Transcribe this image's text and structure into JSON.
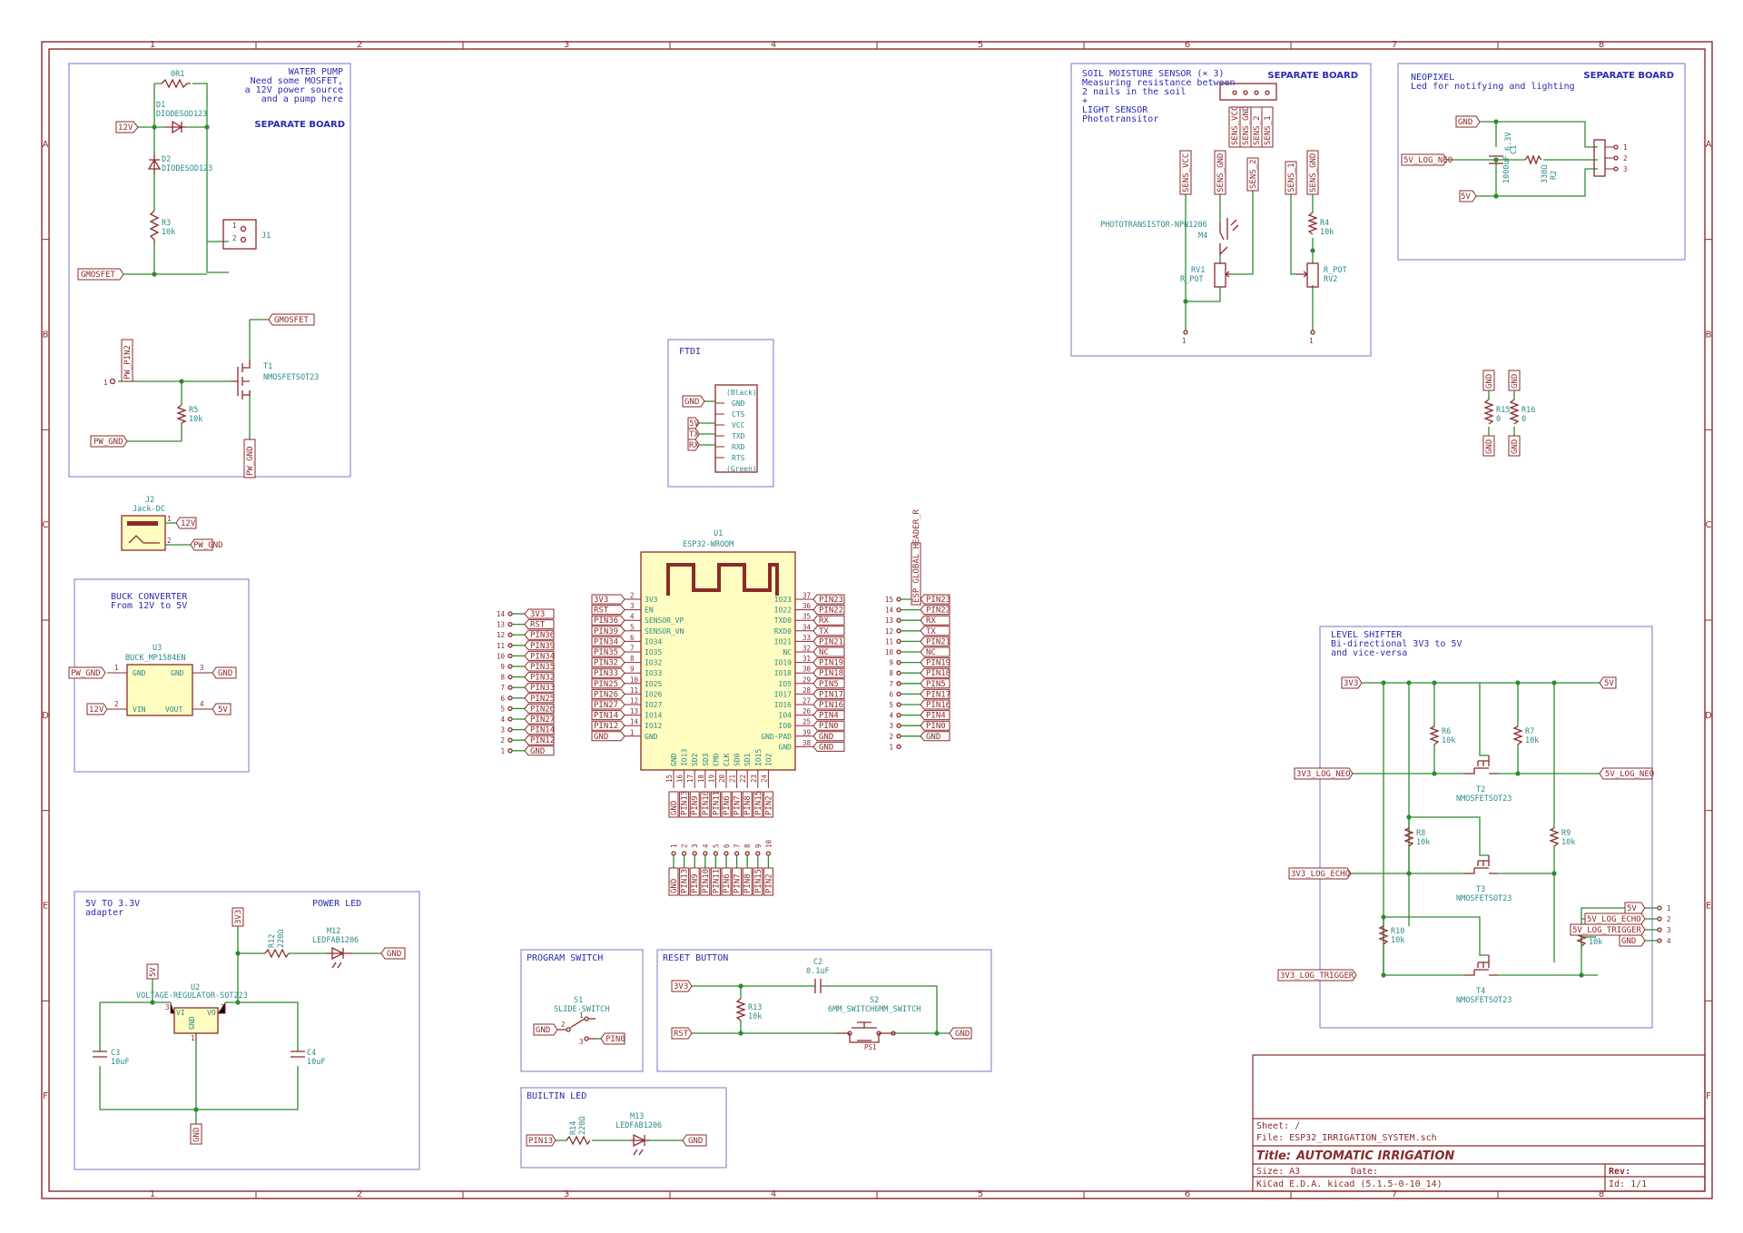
{
  "sheet": {
    "col_labels": [
      "1",
      "2",
      "3",
      "4",
      "5",
      "6",
      "7",
      "8"
    ],
    "row_labels": [
      "A",
      "B",
      "C",
      "D",
      "E",
      "F"
    ]
  },
  "sections": {
    "water_pump": {
      "note": [
        "WATER PUMP",
        "Need some MOSFET,",
        "a 12V power source",
        "and a pump here"
      ],
      "separate": "SEPARATE BOARD"
    },
    "soil": {
      "note": [
        "SOIL MOISTURE SENSOR (× 3)",
        "Measuring resistance between",
        "2 nails in the soil",
        "+",
        "LIGHT SENSOR",
        "Phototransitor"
      ],
      "separate": "SEPARATE BOARD"
    },
    "neopixel": {
      "note": [
        "NEOPIXEL",
        "Led for notifying and lighting"
      ],
      "separate": "SEPARATE BOARD"
    },
    "ftdi": {
      "note": "FTDI"
    },
    "buck": {
      "note": [
        "BUCK CONVERTER",
        "From 12V to 5V"
      ]
    },
    "level_shifter": {
      "note": [
        "LEVEL SHIFTER",
        "Bi-directional 3V3 to 5V",
        "and vice-versa"
      ]
    },
    "regulator": {
      "note": [
        "5V TO 3.3V",
        "adapter"
      ],
      "power_led": "POWER LED"
    },
    "program_switch": {
      "note": "PROGRAM SWITCH"
    },
    "reset_button": {
      "note": "RESET BUTTON"
    },
    "builtin_led": {
      "note": "BUILTIN LED"
    }
  },
  "components": {
    "R1": "0R1",
    "D1": [
      "D1",
      "DIODESOD123"
    ],
    "D2": [
      "D2",
      "DIODESOD123"
    ],
    "R3": [
      "R3",
      "10k"
    ],
    "J1": "J1",
    "T1": [
      "T1",
      "NMOSFETSOT23"
    ],
    "R5": [
      "R5",
      "10k"
    ],
    "J2": [
      "J2",
      "Jack-DC"
    ],
    "U3": [
      "U3",
      "BUCK_MP1584EN"
    ],
    "U1": [
      "U1",
      "ESP32-WROOM"
    ],
    "U2": [
      "U2",
      "VOLTAGE-REGULATOR-SOT223"
    ],
    "C3": [
      "C3",
      "10uF"
    ],
    "C4": [
      "C4",
      "10uF"
    ],
    "R12": [
      "R12",
      "220Ω"
    ],
    "M12": [
      "M12",
      "LEDFAB1206"
    ],
    "S1": [
      "S1",
      "SLIDE-SWITCH"
    ],
    "C2": [
      "C2",
      "0.1uF"
    ],
    "S2": [
      "S2",
      "6MM_SWITCH6MM_SWITCH"
    ],
    "R13": [
      "R13",
      "10k"
    ],
    "R14": [
      "R14",
      "220Ω"
    ],
    "M13": [
      "M13",
      "LEDFAB1206"
    ],
    "M4": "PHOTOTRANSISTOR-NPN1206",
    "M4ref": "M4",
    "RV1": [
      "RV1",
      "R_POT"
    ],
    "RV2": [
      "R_POT",
      "RV2"
    ],
    "R4": [
      "R4",
      "10k"
    ],
    "C1": [
      "1000uF",
      "C1",
      "6.3V"
    ],
    "R2": [
      "330Ω",
      "R2"
    ],
    "R15": "R15",
    "R16": "R16",
    "T2": [
      "T2",
      "NMOSFETSOT23"
    ],
    "T3": [
      "T3",
      "NMOSFETSOT23"
    ],
    "T4": [
      "T4",
      "NMOSFETSOT23"
    ],
    "R6": [
      "R6",
      "10k"
    ],
    "R7": [
      "R7",
      "10k"
    ],
    "R8": [
      "R8",
      "10k"
    ],
    "R9": [
      "R9",
      "10k"
    ],
    "R10": [
      "R10",
      "10k"
    ],
    "R11": [
      "R11",
      "10k"
    ]
  },
  "net_labels": {
    "v12": "12V",
    "v5": "5V",
    "v3v3": "3V3",
    "gnd": "GND",
    "gmosfet": "GMOSFET",
    "pw_gnd": "PW_GND",
    "pw_pin2": "PW_PIN2",
    "tx": "TX",
    "rx": "RX",
    "rst": "RST",
    "sens_vcc": "SENS_VCC",
    "sens_gnd": "SENS_GND",
    "sens_2": "SENS_2",
    "sens_1": "SENS_1",
    "v5_log_neo": "5V_LOG_NEO",
    "v3v3_log_neo": "3V3_LOG_NEO",
    "v3v3_log_echo": "3V3_LOG_ECHO",
    "v3v3_log_trigger": "3V3_LOG_TRIGGER",
    "v5_log_echo": "5V_LOG_ECHO",
    "v5_log_trigger": "5V_LOG_TRIGGER",
    "pin0": "PIN0",
    "pin13": "PIN13"
  },
  "ftdi_pins": [
    "(Black)",
    "GND",
    "CTS",
    "VCC",
    "TXD",
    "RXD",
    "RTS",
    "(Green)"
  ],
  "esp_left": [
    {
      "num": "2",
      "name": "3V3",
      "net": "3V3"
    },
    {
      "num": "3",
      "name": "EN",
      "net": "RST"
    },
    {
      "num": "4",
      "name": "SENSOR_VP",
      "net": "PIN36"
    },
    {
      "num": "5",
      "name": "SENSOR_VN",
      "net": "PIN39"
    },
    {
      "num": "6",
      "name": "IO34",
      "net": "PIN34"
    },
    {
      "num": "7",
      "name": "IO35",
      "net": "PIN35"
    },
    {
      "num": "8",
      "name": "IO32",
      "net": "PIN32"
    },
    {
      "num": "9",
      "name": "IO33",
      "net": "PIN33"
    },
    {
      "num": "10",
      "name": "IO25",
      "net": "PIN25"
    },
    {
      "num": "11",
      "name": "IO26",
      "net": "PIN26"
    },
    {
      "num": "12",
      "name": "IO27",
      "net": "PIN27"
    },
    {
      "num": "13",
      "name": "IO14",
      "net": "PIN14"
    },
    {
      "num": "14",
      "name": "IO12",
      "net": "PIN12"
    },
    {
      "num": "1",
      "name": "GND",
      "net": "GND"
    }
  ],
  "esp_right": [
    {
      "num": "37",
      "name": "IO23",
      "net": "PIN23"
    },
    {
      "num": "36",
      "name": "IO22",
      "net": "PIN22"
    },
    {
      "num": "35",
      "name": "TXD0",
      "net": "RX"
    },
    {
      "num": "34",
      "name": "RXD0",
      "net": "TX"
    },
    {
      "num": "33",
      "name": "IO21",
      "net": "PIN21"
    },
    {
      "num": "32",
      "name": "NC",
      "net": "NC"
    },
    {
      "num": "31",
      "name": "IO19",
      "net": "PIN19"
    },
    {
      "num": "30",
      "name": "IO18",
      "net": "PIN18"
    },
    {
      "num": "29",
      "name": "IO5",
      "net": "PIN5"
    },
    {
      "num": "28",
      "name": "IO17",
      "net": "PIN17"
    },
    {
      "num": "27",
      "name": "IO16",
      "net": "PIN16"
    },
    {
      "num": "26",
      "name": "IO4",
      "net": "PIN4"
    },
    {
      "num": "25",
      "name": "IO0",
      "net": "PIN0"
    },
    {
      "num": "39",
      "name": "GND-PAD",
      "net": "GND"
    },
    {
      "num": "38",
      "name": "GND",
      "net": "GND"
    }
  ],
  "esp_bottom": [
    {
      "num": "15",
      "name": "GND",
      "net": "GND"
    },
    {
      "num": "16",
      "name": "IO13",
      "net": "PIN13"
    },
    {
      "num": "17",
      "name": "SD2",
      "net": "PIN9"
    },
    {
      "num": "18",
      "name": "SD3",
      "net": "PIN10"
    },
    {
      "num": "19",
      "name": "CMD",
      "net": "PIN11"
    },
    {
      "num": "20",
      "name": "CLK",
      "net": "PIN6"
    },
    {
      "num": "21",
      "name": "SD0",
      "net": "PIN7"
    },
    {
      "num": "22",
      "name": "SD1",
      "net": "PIN8"
    },
    {
      "num": "23",
      "name": "IO15",
      "net": "PIN15"
    },
    {
      "num": "24",
      "name": "IO2",
      "net": "PIN2"
    }
  ],
  "hdr_left": {
    "nums": [
      "14",
      "13",
      "12",
      "11",
      "10",
      "9",
      "8",
      "7",
      "6",
      "5",
      "4",
      "3",
      "2",
      "1"
    ],
    "nets": [
      "3V3",
      "RST",
      "PIN36",
      "PIN39",
      "PIN34",
      "PIN35",
      "PIN32",
      "PIN33",
      "PIN25",
      "PIN26",
      "PIN27",
      "PIN14",
      "PIN12",
      "GND"
    ]
  },
  "hdr_right": {
    "nums": [
      "15",
      "14",
      "13",
      "12",
      "11",
      "10",
      "9",
      "8",
      "7",
      "6",
      "5",
      "4",
      "3",
      "2",
      "1"
    ],
    "nets": [
      "PIN23",
      "PIN22",
      "RX",
      "TX",
      "PIN21",
      "NC",
      "PIN19",
      "PIN18",
      "PIN5",
      "PIN17",
      "PIN16",
      "PIN4",
      "PIN0",
      "GND"
    ],
    "vertical": "ESP_GLOBAL_HEADER_R"
  },
  "hdr_bottom": {
    "nums": [
      "1",
      "2",
      "3",
      "4",
      "5",
      "6",
      "7",
      "8",
      "9",
      "10"
    ],
    "nets": [
      "GND",
      "PIN13",
      "PIN9",
      "PIN10",
      "PIN11",
      "PIN6",
      "PIN7",
      "PIN8",
      "PIN15",
      "PIN2"
    ]
  },
  "neo_conn": [
    "1",
    "2",
    "3"
  ],
  "ls_conn": [
    "1",
    "2",
    "3",
    "4"
  ],
  "title_block": {
    "sheet": "Sheet: /",
    "file": "File: ESP32_IRRIGATION_SYSTEM.sch",
    "title_label": "Title:",
    "title": "AUTOMATIC IRRIGATION",
    "size": "Size: A3",
    "date": "Date:",
    "rev": "Rev:",
    "tool": "KiCad E.D.A.  kicad (5.1.5-0-10_14)",
    "id": "Id: 1/1"
  }
}
